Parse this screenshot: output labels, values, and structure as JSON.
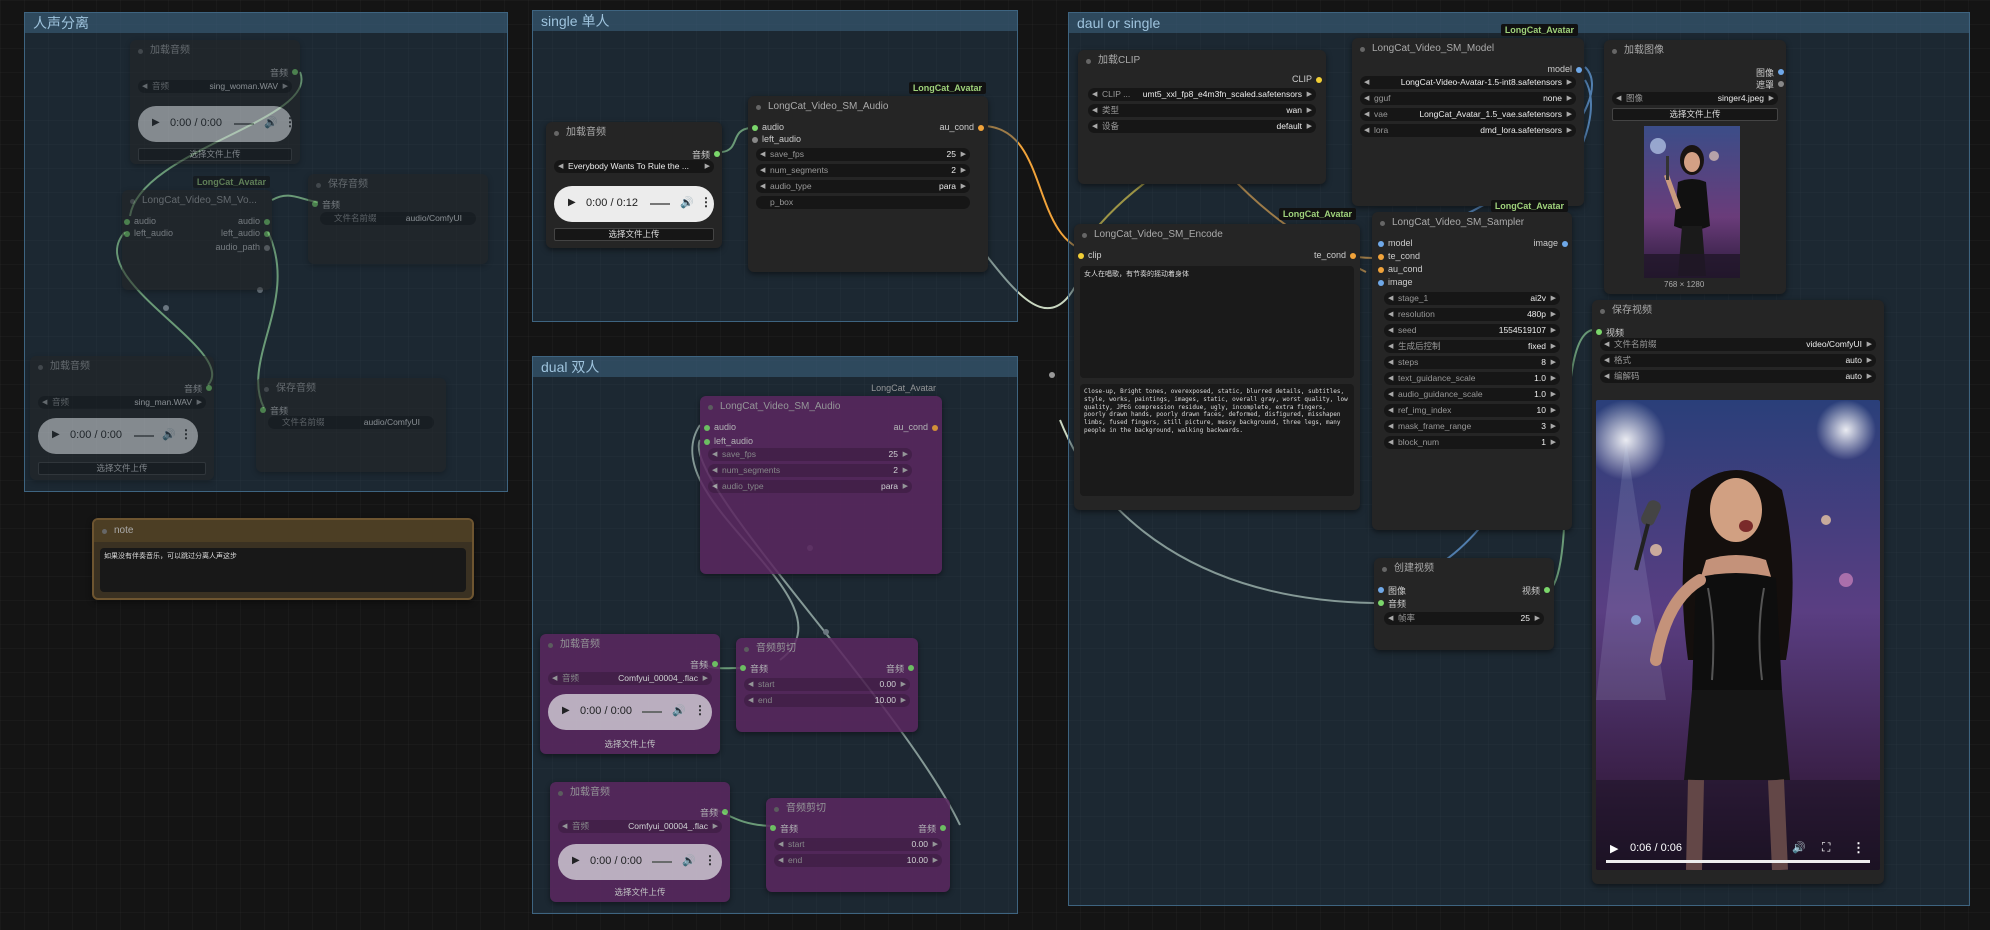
{
  "groups": {
    "vocal_sep": "人声分离",
    "single": "single 单人",
    "dual": "dual 双人",
    "daul_or_single": "daul or single"
  },
  "badge": "LongCat_Avatar",
  "common": {
    "upload": "选择文件上传",
    "audio_port": "音频",
    "audio_in": "audio",
    "left_audio": "left_audio",
    "au_cond": "au_cond",
    "play": "▶",
    "vol": "🔊",
    "menu": "⋮"
  },
  "sep": {
    "load1_title": "加载音频",
    "load1_label": "音频",
    "load1_value": "sing_woman.WAV",
    "load1_time": "0:00 / 0:00",
    "sep_title": "LongCat_Video_SM_Vo...",
    "audio_path": "audio_path",
    "save1_title": "保存音频",
    "save1_label": "文件名前缀",
    "save1_value": "audio/ComfyUI",
    "load2_title": "加载音频",
    "load2_label": "音频",
    "load2_value": "sing_man.WAV",
    "load2_time": "0:00 / 0:00",
    "save2_title": "保存音频",
    "save2_label": "文件名前缀",
    "save2_value": "audio/ComfyUI",
    "note_title": "note",
    "note_text": "如果没有伴奏音乐，可以跳过分离人声这步"
  },
  "single": {
    "load_title": "加载音频",
    "load_value": "Everybody Wants To Rule the ...",
    "load_time": "0:00 / 0:12",
    "audio_title": "LongCat_Video_SM_Audio",
    "widgets": [
      {
        "label": "save_fps",
        "value": "25"
      },
      {
        "label": "num_segments",
        "value": "2"
      },
      {
        "label": "audio_type",
        "value": "para"
      },
      {
        "label": "p_box",
        "value": ""
      }
    ]
  },
  "dual": {
    "audio_title": "LongCat_Video_SM_Audio",
    "widgets": [
      {
        "label": "save_fps",
        "value": "25"
      },
      {
        "label": "num_segments",
        "value": "2"
      },
      {
        "label": "audio_type",
        "value": "para"
      }
    ],
    "load1_title": "加载音频",
    "load1_label": "音频",
    "load1_value": "Comfyui_00004_.flac",
    "load1_time": "0:00 / 0:00",
    "trim1_title": "音频剪切",
    "trim1_rows": [
      {
        "label": "start",
        "value": "0.00"
      },
      {
        "label": "end",
        "value": "10.00"
      }
    ],
    "load2_title": "加载音频",
    "load2_label": "音频",
    "load2_value": "Comfyui_00004_.flac",
    "load2_time": "0:00 / 0:00",
    "trim2_title": "音频剪切",
    "trim2_rows": [
      {
        "label": "start",
        "value": "0.00"
      },
      {
        "label": "end",
        "value": "10.00"
      }
    ]
  },
  "main": {
    "clip_title": "加载CLIP",
    "clip_out": "CLIP",
    "clip_widgets": [
      {
        "label": "CLIP ...",
        "value": "umt5_xxl_fp8_e4m3fn_scaled.safetensors"
      },
      {
        "label": "类型",
        "value": "wan"
      },
      {
        "label": "设备",
        "value": "default"
      }
    ],
    "model_title": "LongCat_Video_SM_Model",
    "model_out": "model",
    "model_widgets": [
      {
        "label": "",
        "value": "LongCat-Video-Avatar-1.5-int8.safetensors"
      },
      {
        "label": "gguf",
        "value": "none"
      },
      {
        "label": "vae",
        "value": "LongCat_Avatar_1.5_vae.safetensors"
      },
      {
        "label": "lora",
        "value": "dmd_lora.safetensors"
      }
    ],
    "image_title": "加载图像",
    "image_out1": "图像",
    "image_out2": "遮罩",
    "image_label": "图像",
    "image_value": "singer4.jpeg",
    "image_dims": "768 × 1280",
    "encode_title": "LongCat_Video_SM_Encode",
    "encode_in": "clip",
    "encode_out": "te_cond",
    "prompt_pos": "女人在唱歌，有节奏的摇动着身体",
    "prompt_neg": "Close-up, Bright tones, overexposed, static, blurred details, subtitles, style, works, paintings, images, static, overall gray, worst quality, low quality, JPEG compression residue, ugly, incomplete, extra fingers, poorly drawn hands, poorly drawn faces, deformed, disfigured, misshapen limbs, fused fingers, still picture, messy background, three legs, many people in the background, walking backwards.",
    "sampler_title": "LongCat_Video_SM_Sampler",
    "sampler_ins": [
      "model",
      "te_cond",
      "au_cond",
      "image"
    ],
    "sampler_out": "image",
    "sampler_widgets": [
      {
        "label": "stage_1",
        "value": "ai2v"
      },
      {
        "label": "resolution",
        "value": "480p"
      },
      {
        "label": "seed",
        "value": "1554519107"
      },
      {
        "label": "生成后控制",
        "value": "fixed"
      },
      {
        "label": "steps",
        "value": "8"
      },
      {
        "label": "text_guidance_scale",
        "value": "1.0"
      },
      {
        "label": "audio_guidance_scale",
        "value": "1.0"
      },
      {
        "label": "ref_img_index",
        "value": "10"
      },
      {
        "label": "mask_frame_range",
        "value": "3"
      },
      {
        "label": "block_num",
        "value": "1"
      }
    ],
    "video_title": "创建视频",
    "video_in1": "图像",
    "video_in2": "音频",
    "video_out": "视频",
    "video_fps_label": "帧率",
    "video_fps_value": "25",
    "save_title": "保存视频",
    "save_in": "视频",
    "save_widgets": [
      {
        "label": "文件名前缀",
        "value": "video/ComfyUI"
      },
      {
        "label": "格式",
        "value": "auto"
      },
      {
        "label": "编解码",
        "value": "auto"
      }
    ],
    "video_time": "0:06 / 0:06"
  }
}
